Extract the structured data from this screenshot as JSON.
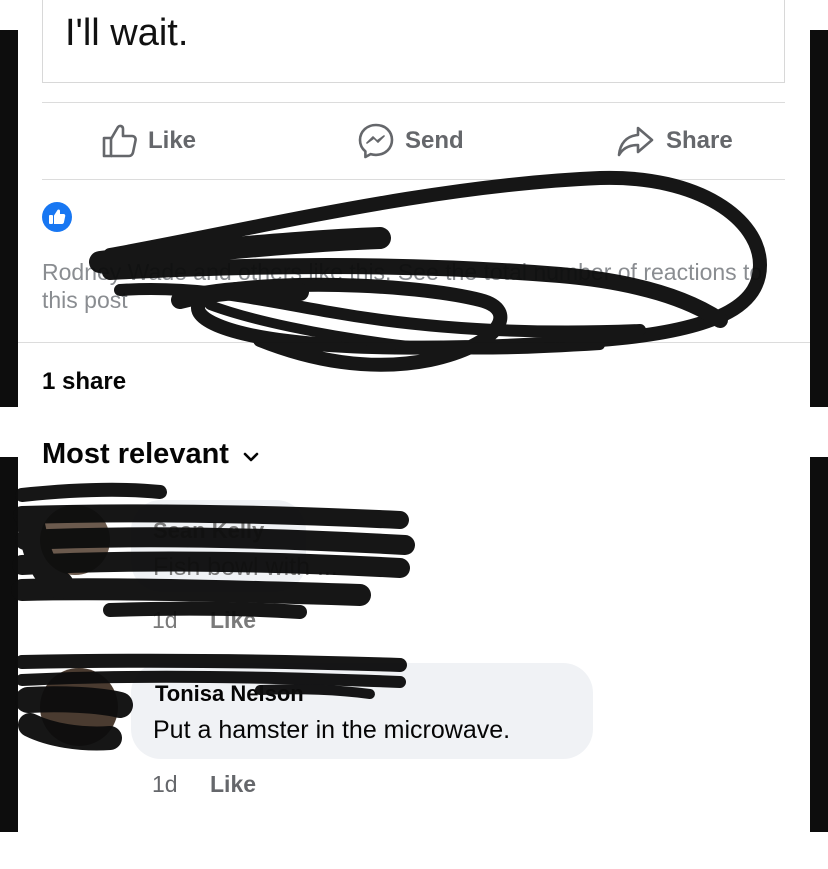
{
  "post": {
    "text": "I'll wait."
  },
  "actions": {
    "like_label": "Like",
    "send_label": "Send",
    "share_label": "Share"
  },
  "reactions": {
    "text": "Rodney Wade and others like this. See the total number of reactions to this post"
  },
  "shares": {
    "label": "1 share"
  },
  "sort": {
    "label": "Most relevant"
  },
  "comments": [
    {
      "author": "Sean Kelly",
      "text": "Fish bowl with ...",
      "time": "1d",
      "like_label": "Like"
    },
    {
      "author": "Tonisa Nelson",
      "text": "Put a hamster in the microwave.",
      "time": "1d",
      "like_label": "Like"
    }
  ],
  "colors": {
    "brand_blue": "#1877f2",
    "secondary_text": "#65676b",
    "bubble": "#f0f2f5",
    "frame": "#0d0d0d"
  }
}
